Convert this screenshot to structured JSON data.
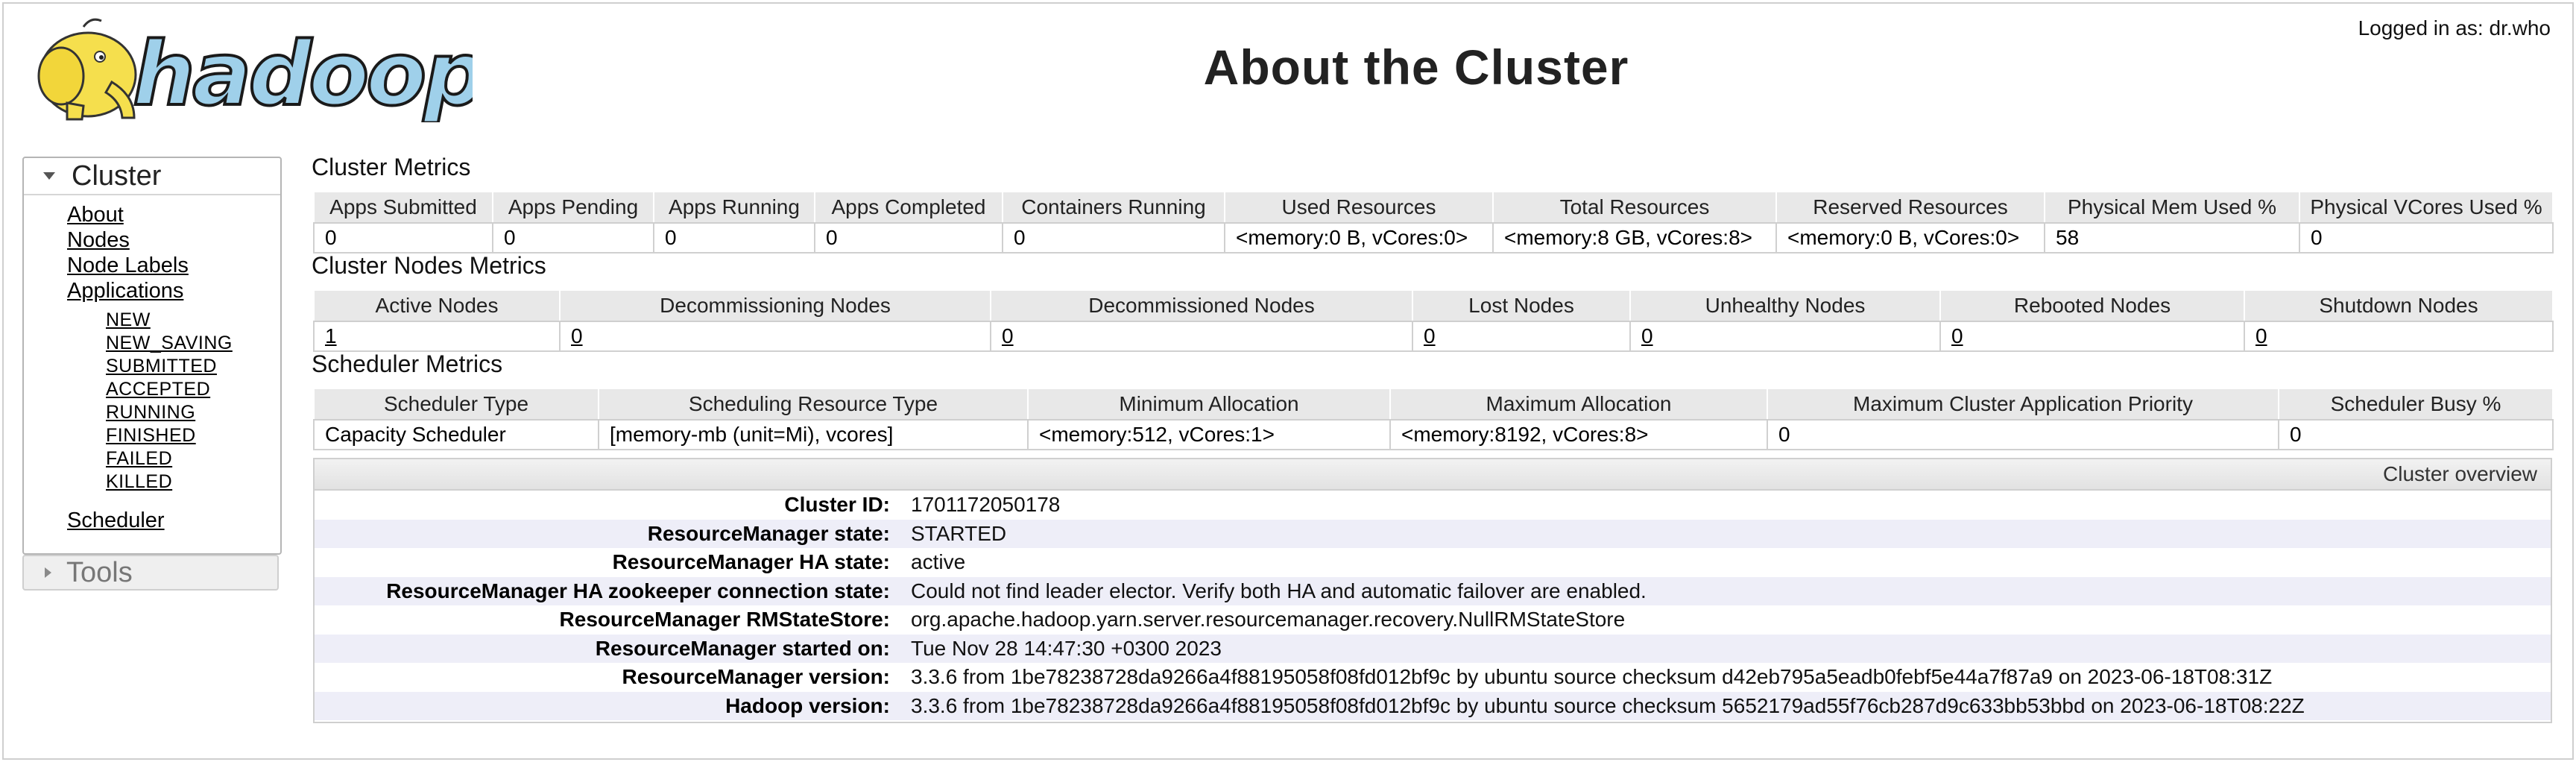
{
  "header": {
    "title": "About the Cluster",
    "logged_in": "Logged in as: dr.who",
    "logo_text": "hadoop"
  },
  "sidebar": {
    "cluster_label": "Cluster",
    "links": [
      "About",
      "Nodes",
      "Node Labels",
      "Applications"
    ],
    "app_states": [
      "NEW",
      "NEW_SAVING",
      "SUBMITTED",
      "ACCEPTED",
      "RUNNING",
      "FINISHED",
      "FAILED",
      "KILLED"
    ],
    "scheduler_label": "Scheduler",
    "tools_label": "Tools"
  },
  "cluster_metrics": {
    "title": "Cluster Metrics",
    "headers": [
      "Apps Submitted",
      "Apps Pending",
      "Apps Running",
      "Apps Completed",
      "Containers Running",
      "Used Resources",
      "Total Resources",
      "Reserved Resources",
      "Physical Mem Used %",
      "Physical VCores Used %"
    ],
    "values": [
      "0",
      "0",
      "0",
      "0",
      "0",
      "<memory:0 B, vCores:0>",
      "<memory:8 GB, vCores:8>",
      "<memory:0 B, vCores:0>",
      "58",
      "0"
    ]
  },
  "nodes_metrics": {
    "title": "Cluster Nodes Metrics",
    "headers": [
      "Active Nodes",
      "Decommissioning Nodes",
      "Decommissioned Nodes",
      "Lost Nodes",
      "Unhealthy Nodes",
      "Rebooted Nodes",
      "Shutdown Nodes"
    ],
    "values": [
      "1",
      "0",
      "0",
      "0",
      "0",
      "0",
      "0"
    ]
  },
  "scheduler_metrics": {
    "title": "Scheduler Metrics",
    "headers": [
      "Scheduler Type",
      "Scheduling Resource Type",
      "Minimum Allocation",
      "Maximum Allocation",
      "Maximum Cluster Application Priority",
      "Scheduler Busy %"
    ],
    "values": [
      "Capacity Scheduler",
      "[memory-mb (unit=Mi), vcores]",
      "<memory:512, vCores:1>",
      "<memory:8192, vCores:8>",
      "0",
      "0"
    ]
  },
  "overview": {
    "title": "Cluster overview",
    "rows": [
      {
        "key": "Cluster ID:",
        "value": "1701172050178"
      },
      {
        "key": "ResourceManager state:",
        "value": "STARTED"
      },
      {
        "key": "ResourceManager HA state:",
        "value": "active"
      },
      {
        "key": "ResourceManager HA zookeeper connection state:",
        "value": "Could not find leader elector. Verify both HA and automatic failover are enabled."
      },
      {
        "key": "ResourceManager RMStateStore:",
        "value": "org.apache.hadoop.yarn.server.resourcemanager.recovery.NullRMStateStore"
      },
      {
        "key": "ResourceManager started on:",
        "value": "Tue Nov 28 14:47:30 +0300 2023"
      },
      {
        "key": "ResourceManager version:",
        "value": "3.3.6 from 1be78238728da9266a4f88195058f08fd012bf9c by ubuntu source checksum d42eb795a5eadb0febf5e44a7f87a9 on 2023-06-18T08:31Z"
      },
      {
        "key": "Hadoop version:",
        "value": "3.3.6 from 1be78238728da9266a4f88195058f08fd012bf9c by ubuntu source checksum 5652179ad55f76cb287d9c633bb53bbd on 2023-06-18T08:22Z"
      }
    ]
  },
  "colors": {
    "logo_blue": "#9fd0ea",
    "logo_yellow": "#f5df4d",
    "header_bg": "#e8e8e8",
    "alt_row": "#eeeef8"
  }
}
